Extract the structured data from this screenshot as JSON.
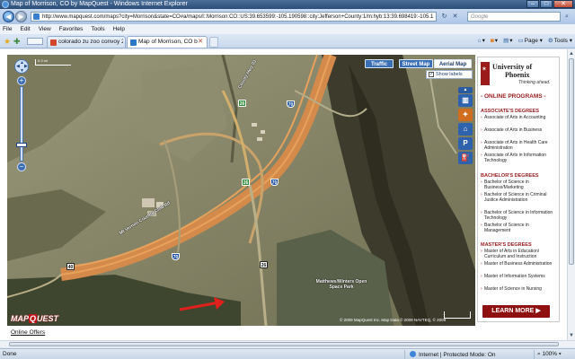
{
  "window": {
    "title": "Map of Morrison, CO by MapQuest - Windows Internet Explorer"
  },
  "address": {
    "url": "http://www.mapquest.com/maps?city=Morrison&state=CO#a/maps/l::Morrison:CO::US:39.653599:-105.190598::city:Jefferson+County:1/m:hyb:13:39.698419:-105.1"
  },
  "search": {
    "placeholder": "Google"
  },
  "menu": [
    "File",
    "Edit",
    "View",
    "Favorites",
    "Tools",
    "Help"
  ],
  "tabs": [
    {
      "label": "colorado zu zoo convoy 20...",
      "active": false
    },
    {
      "label": "Map of Morrison, CO b...",
      "active": true
    }
  ],
  "commands": {
    "home": "",
    "feeds": "",
    "print": "",
    "page": "Page",
    "tools": "Tools"
  },
  "map": {
    "map_types": {
      "traffic": "Traffic",
      "street": "Street Map",
      "aerial": "Aerial Map"
    },
    "show_labels": "Show labels",
    "scale": "0.3 mi",
    "shields": {
      "us40": "40",
      "co26a": "26",
      "i70a": "70",
      "co26b": "26",
      "i70b": "70",
      "us26": "26",
      "i70c": "70"
    },
    "labels": {
      "road1": "Mt Vernon Country Club Rd",
      "road2": "County Hwy 93",
      "park": "Matthews/Winters Open Space Park",
      "exit": ""
    },
    "logo": {
      "brand": "MAP",
      "q": "Q",
      "rest": "UEST"
    },
    "copyright": "© 2009 MapQuest Inc. Map Data © 2009 NAVTEQ, © 2009"
  },
  "ad": {
    "university_line1": "University of",
    "university_line2": "Phoenix",
    "tagline": "Thinking ahead.",
    "heading": "- ONLINE PROGRAMS -",
    "sections": [
      {
        "title": "ASSOCIATE'S DEGREES",
        "items": [
          "Associate of Arts in Accounting",
          "Associate of Arts in Business",
          "Associate of Arts in Health Care Administration",
          "Associate of Arts in Information Technology"
        ]
      },
      {
        "title": "BACHELOR'S DEGREES",
        "items": [
          "Bachelor of Science in Business/Marketing",
          "Bachelor of Science in Criminal Justice Administration",
          "Bachelor of Science in Information Technology",
          "Bachelor of Science in Management"
        ]
      },
      {
        "title": "MASTER'S DEGREES",
        "items": [
          "Master of Arts in Education/ Curriculum and Instruction",
          "Master of Business Administration",
          "Master of Information Systems",
          "Master of Science in Nursing"
        ]
      }
    ],
    "cta": "LEARN MORE"
  },
  "page": {
    "online_offers": "Online Offers"
  },
  "status": {
    "left": "Done",
    "zone": "Internet | Protected Mode: On",
    "zoom": "100%"
  },
  "colors": {
    "titlebar": "#2b4d78",
    "brand_red": "#9b1b1b",
    "mapquest_red": "#c0151b",
    "road_orange": "#e38a3c",
    "arrow_red": "#e0201b"
  },
  "icons": {
    "back": "back-arrow-icon",
    "forward": "forward-arrow-icon",
    "refresh": "refresh-icon",
    "stop": "stop-icon",
    "search": "magnifier-icon",
    "favorites": "star-icon",
    "add_favorites": "add-favorites-icon",
    "home": "home-icon",
    "feeds": "rss-icon",
    "print": "printer-icon"
  }
}
